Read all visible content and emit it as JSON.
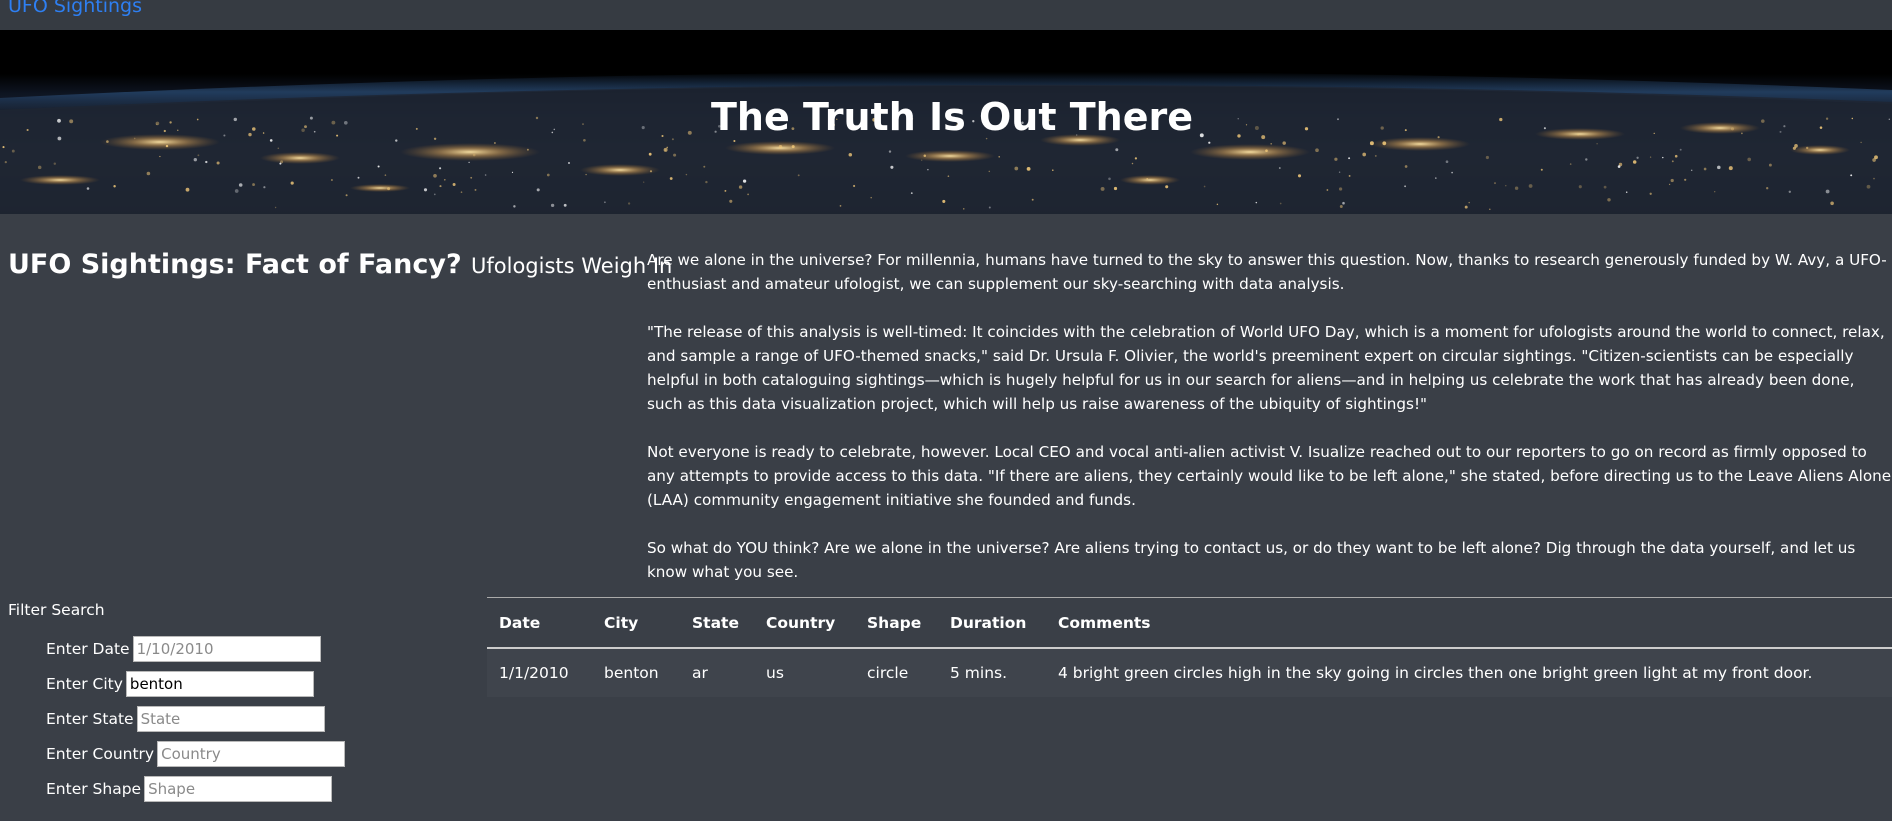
{
  "navbar": {
    "brand": "UFO Sightings"
  },
  "hero": {
    "title": "The Truth Is Out There"
  },
  "heading": {
    "title": "UFO Sightings: Fact of Fancy?",
    "subtitle": "Ufologists Weigh In"
  },
  "article": {
    "paragraphs": [
      "Are we alone in the universe? For millennia, humans have turned to the sky to answer this question. Now, thanks to research generously funded by W. Avy, a UFO-enthusiast and amateur ufologist, we can supplement our sky-searching with data analysis.",
      "\"The release of this analysis is well-timed: It coincides with the celebration of World UFO Day, which is a moment for ufologists around the world to connect, relax, and sample a range of UFO-themed snacks,\" said Dr. Ursula F. Olivier, the world's preeminent expert on circular sightings. \"Citizen-scientists can be especially helpful in both cataloguing sightings—which is hugely helpful for us in our search for aliens—and in helping us celebrate the work that has already been done, such as this data visualization project, which will help us raise awareness of the ubiquity of sightings!\"",
      "Not everyone is ready to celebrate, however. Local CEO and vocal anti-alien activist V. Isualize reached out to our reporters to go on record as firmly opposed to any attempts to provide access to this data. \"If there are aliens, they certainly would like to be left alone,\" she stated, before directing us to the Leave Aliens Alone (LAA) community engagement initiative she founded and funds.",
      "So what do YOU think? Are we alone in the universe? Are aliens trying to contact us, or do they want to be left alone? Dig through the data yourself, and let us know what you see."
    ]
  },
  "filter": {
    "title": "Filter Search",
    "fields": [
      {
        "label": "Enter Date",
        "value": "",
        "placeholder": "1/10/2010"
      },
      {
        "label": "Enter City",
        "value": "benton",
        "placeholder": ""
      },
      {
        "label": "Enter State",
        "value": "",
        "placeholder": "State"
      },
      {
        "label": "Enter Country",
        "value": "",
        "placeholder": "Country"
      },
      {
        "label": "Enter Shape",
        "value": "",
        "placeholder": "Shape"
      }
    ]
  },
  "table": {
    "headers": [
      "Date",
      "City",
      "State",
      "Country",
      "Shape",
      "Duration",
      "Comments"
    ],
    "rows": [
      [
        "1/1/2010",
        "benton",
        "ar",
        "us",
        "circle",
        "5 mins.",
        "4 bright green circles high in the sky going in circles then one bright green light at my front door."
      ]
    ]
  }
}
